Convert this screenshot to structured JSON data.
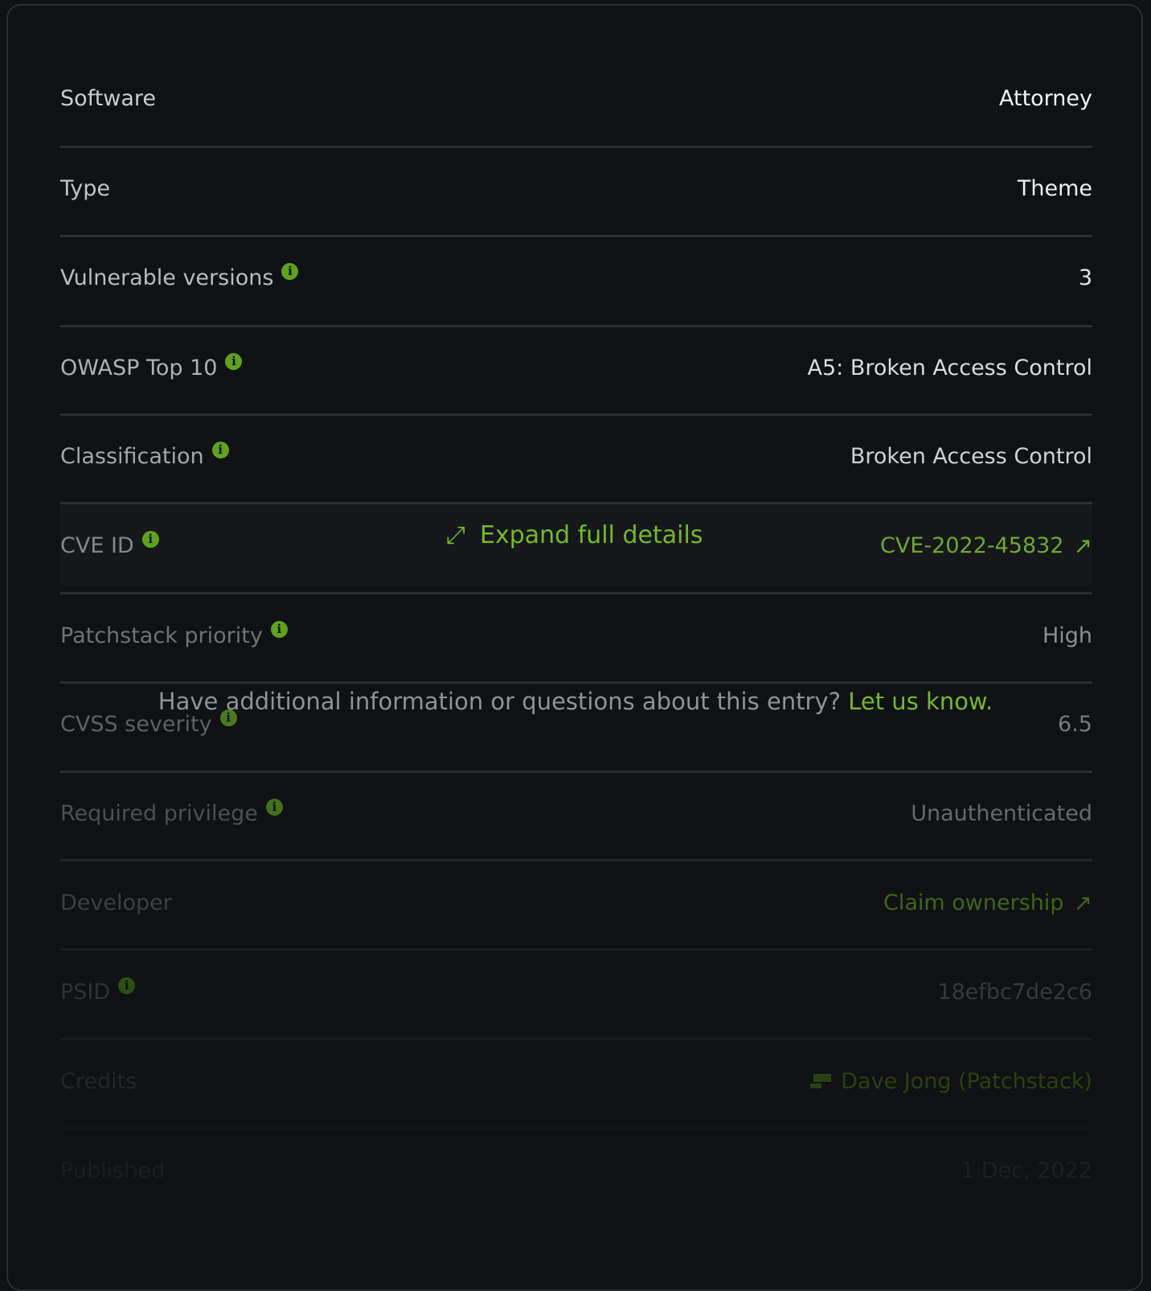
{
  "rows": [
    {
      "label": "Software",
      "value": "Attorney",
      "info": false
    },
    {
      "label": "Type",
      "value": "Theme",
      "info": false
    },
    {
      "label": "Vulnerable versions",
      "value": "3",
      "info": true
    },
    {
      "label": "OWASP Top 10",
      "value": "A5: Broken Access Control",
      "info": true
    },
    {
      "label": "Classification",
      "value": "Broken Access Control",
      "info": true
    },
    {
      "label": "CVE ID",
      "value": "CVE-2022-45832",
      "info": true
    },
    {
      "label": "Patchstack priority",
      "value": "High",
      "info": true
    },
    {
      "label": "CVSS severity",
      "value": "6.5",
      "info": true
    },
    {
      "label": "Required privilege",
      "value": "Unauthenticated",
      "info": true
    },
    {
      "label": "Developer",
      "value": "Claim ownership",
      "info": false
    },
    {
      "label": "PSID",
      "value": "18efbc7de2c6",
      "info": true
    },
    {
      "label": "Credits",
      "value": "Dave Jong (Patchstack)",
      "info": false
    },
    {
      "label": "Published",
      "value": "1 Dec, 2022",
      "info": false
    }
  ],
  "overlay": {
    "expand_label": "Expand full details",
    "question_text": "Have additional information or questions about this entry?",
    "question_link": "Let us know."
  },
  "icons": {
    "info": "info-icon",
    "external": "external-link-icon",
    "expand": "expand-icon",
    "credit": "chat-icon"
  },
  "colors": {
    "accent": "#76b82a",
    "background": "#101114"
  }
}
